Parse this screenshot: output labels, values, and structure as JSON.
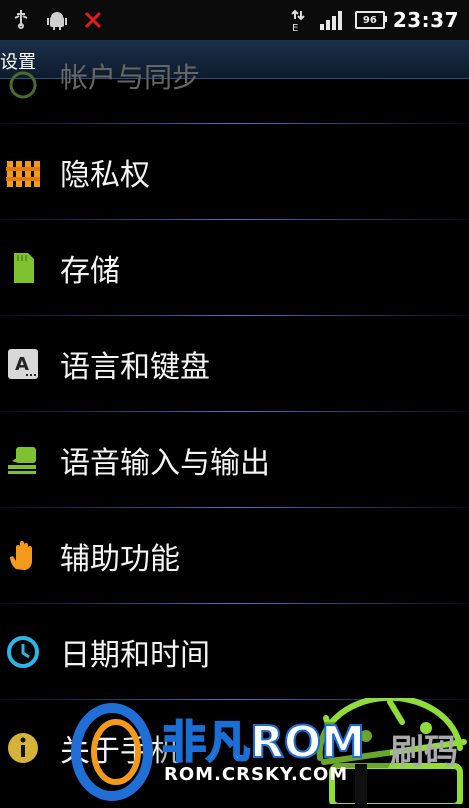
{
  "status_bar": {
    "time": "23:37",
    "battery_level": "96",
    "network_type": "E"
  },
  "title_bar": {
    "title": "设置"
  },
  "settings_list": [
    {
      "label": "帐户与同步",
      "icon": "sync-icon"
    },
    {
      "label": "隐私权",
      "icon": "privacy-fence-icon"
    },
    {
      "label": "存储",
      "icon": "sd-card-icon"
    },
    {
      "label": "语言和键盘",
      "icon": "keyboard-icon"
    },
    {
      "label": "语音输入与输出",
      "icon": "voice-io-icon"
    },
    {
      "label": "辅助功能",
      "icon": "hand-icon"
    },
    {
      "label": "日期和时间",
      "icon": "clock-icon"
    },
    {
      "label": "关于手机",
      "icon": "info-icon"
    }
  ],
  "watermark": {
    "brand": "非凡ROM",
    "url": "ROM.CRSKY.COM",
    "partial_text": "刷码"
  },
  "colors": {
    "accent": "#3b74c7",
    "title_bg": "#1c2f4a",
    "status_bg": "#0b0b0b",
    "android_green": "#8fdc3a"
  }
}
